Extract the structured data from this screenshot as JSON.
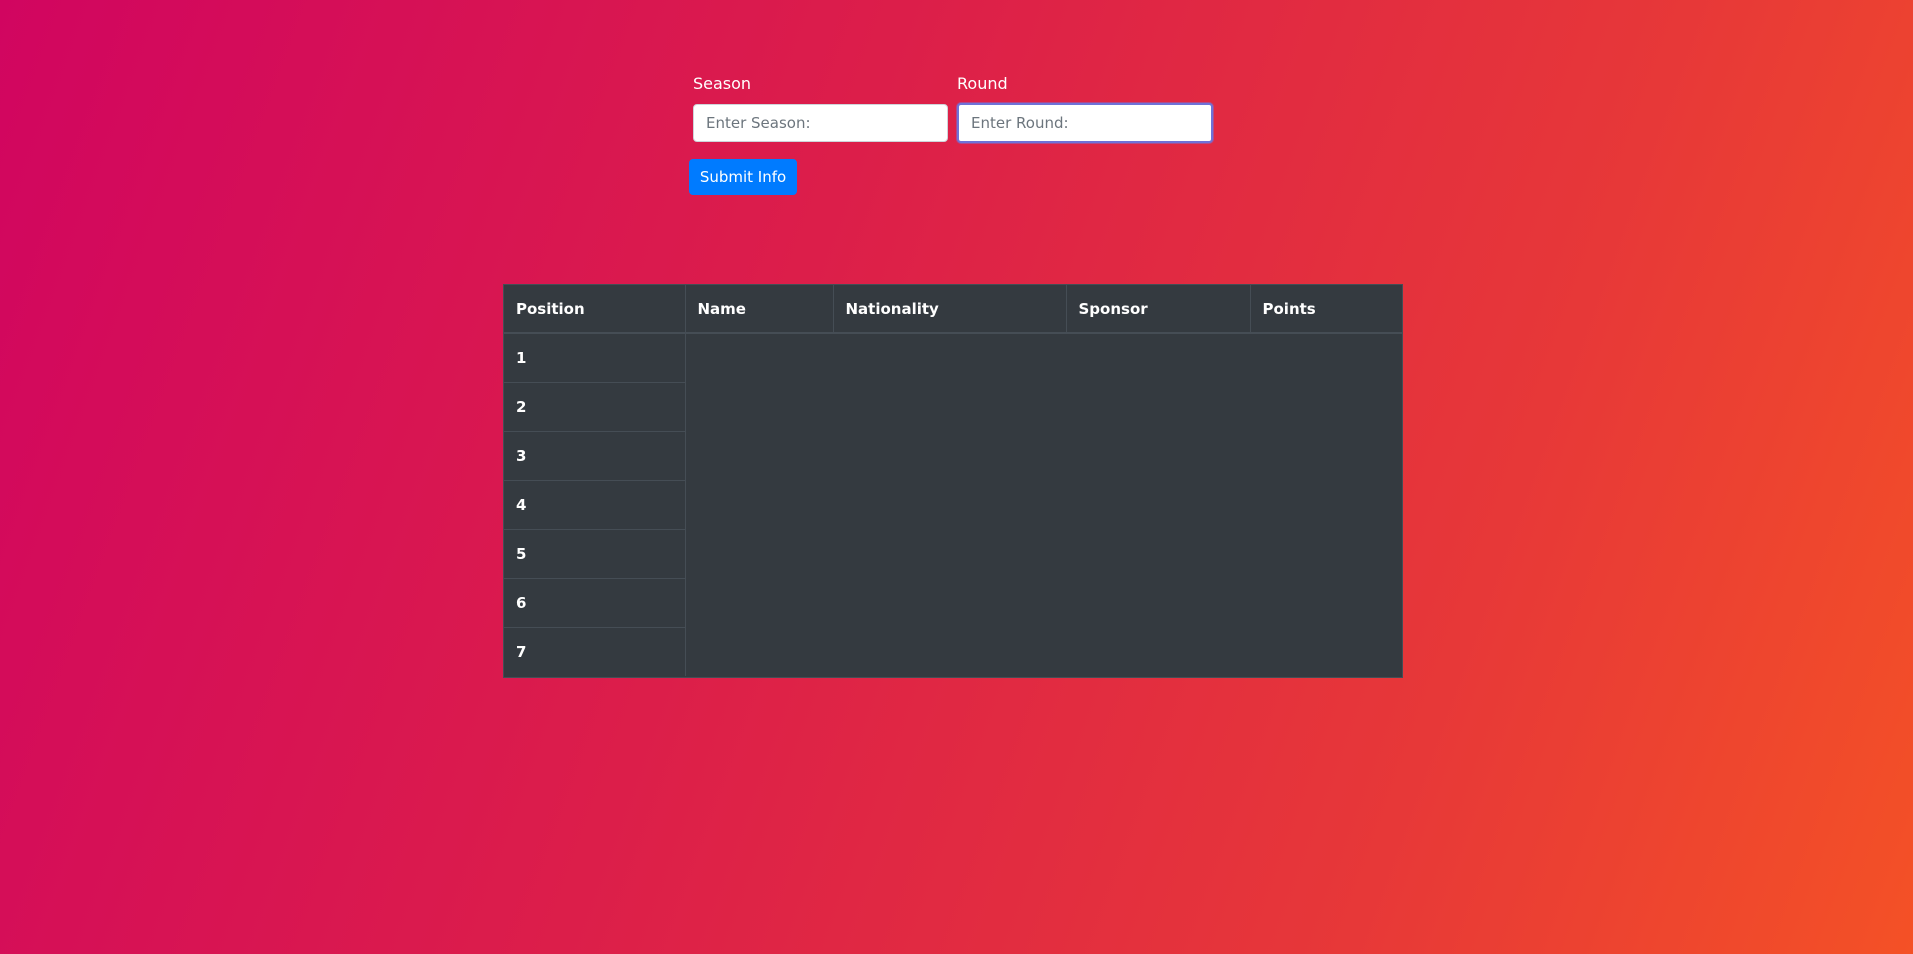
{
  "form": {
    "season_label": "Season",
    "season_placeholder": "Enter Season:",
    "season_value": "",
    "round_label": "Round",
    "round_placeholder": "Enter Round:",
    "round_value": "",
    "submit_label": "Submit Info"
  },
  "table": {
    "headers": {
      "position": "Position",
      "name": "Name",
      "nationality": "Nationality",
      "sponsor": "Sponsor",
      "points": "Points"
    },
    "rows": [
      {
        "position": "1"
      },
      {
        "position": "2"
      },
      {
        "position": "3"
      },
      {
        "position": "4"
      },
      {
        "position": "5"
      },
      {
        "position": "6"
      },
      {
        "position": "7"
      }
    ]
  },
  "colors": {
    "gradient_start": "#d10560",
    "gradient_end": "#f45126",
    "button": "#007bff",
    "table_bg": "#343a40"
  }
}
